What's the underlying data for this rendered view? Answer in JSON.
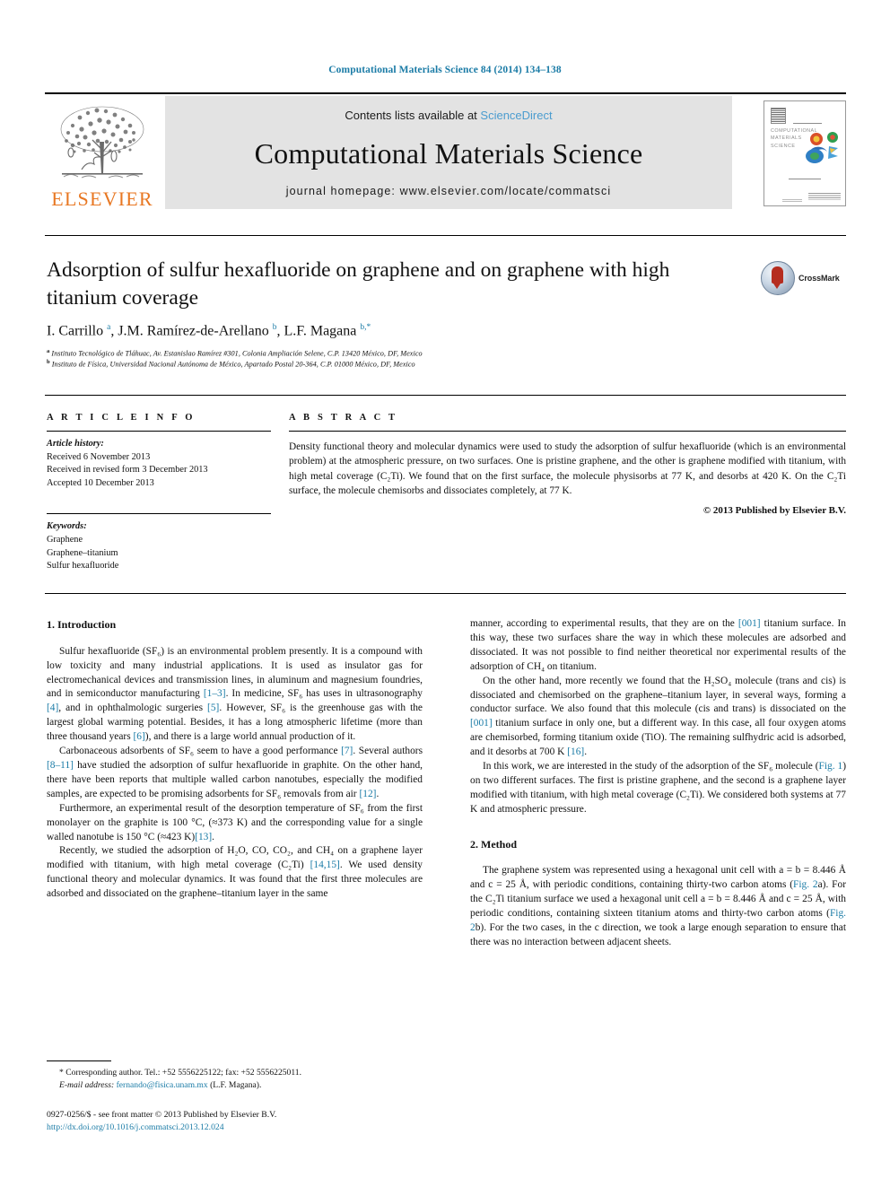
{
  "running_head": "Computational Materials Science 84 (2014) 134–138",
  "masthead": {
    "contents_prefix": "Contents lists available at ",
    "sciencedirect": "ScienceDirect",
    "journal_title": "Computational Materials Science",
    "homepage": "journal homepage: www.elsevier.com/locate/commatsci",
    "publisher_logo_text": "ELSEVIER",
    "cover_title_lines": [
      "COMPUTATIONAL",
      "MATERIALS",
      "SCIENCE"
    ]
  },
  "article": {
    "title": "Adsorption of sulfur hexafluoride on graphene and on graphene with high titanium coverage",
    "crossmark_label": "CrossMark",
    "authors_html": "I. Carrillo <sup>a</sup>, J.M. Ramírez-de-Arellano <sup>b</sup>, L.F. Magana <sup>b,</sup><sup>*</sup>",
    "affiliation_a": "Instituto Tecnológico de Tláhuac, Av. Estanislao Ramírez #301, Colonia Ampliación Selene, C.P. 13420 México, DF, Mexico",
    "affiliation_b": "Instituto de Física, Universidad Nacional Autónoma de México, Apartado Postal 20-364, C.P. 01000 México, DF, Mexico"
  },
  "article_info": {
    "label": "A R T I C L E    I N F O",
    "history_label": "Article history:",
    "history": [
      "Received 6 November 2013",
      "Received in revised form 3 December 2013",
      "Accepted 10 December 2013"
    ],
    "keywords_label": "Keywords:",
    "keywords": [
      "Graphene",
      "Graphene–titanium",
      "Sulfur hexafluoride"
    ]
  },
  "abstract": {
    "label": "A B S T R A C T",
    "text": "Density functional theory and molecular dynamics were used to study the adsorption of sulfur hexafluoride (which is an environmental problem) at the atmospheric pressure, on two surfaces. One is pristine graphene, and the other is graphene modified with titanium, with high metal coverage (C₂Ti). We found that on the first surface, the molecule physisorbs at 77 K, and desorbs at 420 K. On the C₂Ti surface, the molecule chemisorbs and dissociates completely, at 77 K.",
    "copyright": "© 2013 Published by Elsevier B.V."
  },
  "sections": {
    "introduction_heading": "1. Introduction",
    "method_heading": "2. Method"
  },
  "left_column_paragraphs": [
    "Sulfur hexafluoride (SF₆) is an environmental problem presently. It is a compound with low toxicity and many industrial applications. It is used as insulator gas for electromechanical devices and transmission lines, in aluminum and magnesium foundries, and in semiconductor manufacturing [1–3]. In medicine, SF₆ has uses in ultrasonography [4], and in ophthalmologic surgeries [5]. However, SF₆ is the greenhouse gas with the largest global warming potential. Besides, it has a long atmospheric lifetime (more than three thousand years [6]), and there is a large world annual production of it.",
    "Carbonaceous adsorbents of SF₆ seem to have a good performance [7]. Several authors [8–11] have studied the adsorption of sulfur hexafluoride in graphite. On the other hand, there have been reports that multiple walled carbon nanotubes, especially the modified samples, are expected to be promising adsorbents for SF₆ removals from air [12].",
    "Furthermore, an experimental result of the desorption temperature of SF₆ from the first monolayer on the graphite is 100 °C, (≈373 K) and the corresponding value for a single walled nanotube is 150 °C (≈423 K)[13].",
    "Recently, we studied the adsorption of H₂O, CO, CO₂, and CH₄ on a graphene layer modified with titanium, with high metal coverage (C₂Ti) [14,15]. We used density functional theory and molecular dynamics. It was found that the first three molecules are adsorbed and dissociated on the graphene–titanium layer in the same"
  ],
  "right_column_paragraphs": [
    "manner, according to experimental results, that they are on the [001] titanium surface. In this way, these two surfaces share the way in which these molecules are adsorbed and dissociated. It was not possible to find neither theoretical nor experimental results of the adsorption of CH₄ on titanium.",
    "On the other hand, more recently we found that the H₂SO₄ molecule (trans and cis) is dissociated and chemisorbed on the graphene–titanium layer, in several ways, forming a conductor surface. We also found that this molecule (cis and trans) is dissociated on the [001] titanium surface in only one, but a different way. In this case, all four oxygen atoms are chemisorbed, forming titanium oxide (TiO). The remaining sulfhydric acid is adsorbed, and it desorbs at 700 K [16].",
    "In this work, we are interested in the study of the adsorption of the SF₆ molecule (Fig. 1) on two different surfaces. The first is pristine graphene, and the second is a graphene layer modified with titanium, with high metal coverage (C₂Ti). We considered both systems at 77 K and atmospheric pressure.",
    "The graphene system was represented using a hexagonal unit cell with a = b = 8.446 Å and c = 25 Å, with periodic conditions, containing thirty-two carbon atoms (Fig. 2a). For the C₂Ti titanium surface we used a hexagonal unit cell a = b = 8.446 Å and c = 25 Å, with periodic conditions, containing sixteen titanium atoms and thirty-two carbon atoms (Fig. 2b). For the two cases, in the c direction, we took a large enough separation to ensure that there was no interaction between adjacent sheets."
  ],
  "footnote": {
    "marker": "*",
    "corresponding": "Corresponding author. Tel.: +52 5556225122; fax: +52 5556225011.",
    "email_label": "E-mail address:",
    "email": "fernando@fisica.unam.mx",
    "email_owner": "(L.F. Magana)."
  },
  "issn": {
    "line": "0927-0256/$ - see front matter © 2013 Published by Elsevier B.V.",
    "doi": "http://dx.doi.org/10.1016/j.commatsci.2013.12.024"
  },
  "colors": {
    "link": "#1a7ba6",
    "sciencedirect": "#4b9ccf",
    "elsevier_orange": "#E87722",
    "band_grey": "#e3e3e3"
  }
}
